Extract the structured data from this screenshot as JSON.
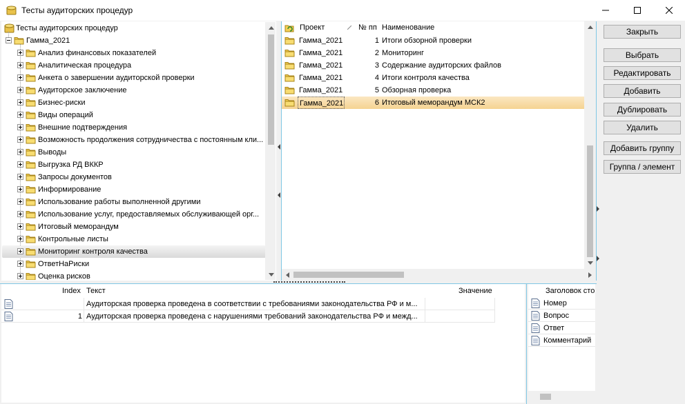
{
  "window": {
    "title": "Тесты аудиторских процедур",
    "controls": {
      "minimize": "minimize",
      "maximize": "maximize",
      "close": "close"
    }
  },
  "tree": {
    "root_label": "Тесты аудиторских процедур",
    "group_label": "Гамма_2021",
    "items": [
      "Анализ финансовых показателей",
      "Аналитическая процедура",
      "Анкета о завершении аудиторской проверки",
      "Аудиторское заключение",
      "Бизнес-риски",
      "Виды операций",
      "Внешние подтверждения",
      "Возможность продолжения сотрудничества с постоянным кли...",
      "Выводы",
      "Выгрузка РД ВККР",
      "Запросы документов",
      "Информирование",
      "Использование работы выполненной другими",
      "Использование услуг, предоставляемых обслуживающей орг...",
      "Итоговый меморандум",
      "Контрольные листы",
      "Мониторинг контроля качества",
      "ОтветНаРиски",
      "Оценка рисков"
    ],
    "selected_index": 16
  },
  "grid": {
    "columns": {
      "project": "Проект",
      "number": "№ пп",
      "name": "Наименование"
    },
    "rows": [
      {
        "project": "Гамма_2021",
        "number": "1",
        "name": "Итоги обзорной проверки"
      },
      {
        "project": "Гамма_2021",
        "number": "2",
        "name": "Мониторинг"
      },
      {
        "project": "Гамма_2021",
        "number": "3",
        "name": "Содержание аудиторских файлов"
      },
      {
        "project": "Гамма_2021",
        "number": "4",
        "name": "Итоги контроля качества"
      },
      {
        "project": "Гамма_2021",
        "number": "5",
        "name": "Обзорная проверка"
      },
      {
        "project": "Гамма_2021",
        "number": "6",
        "name": "Итоговый меморандум МСК2"
      }
    ],
    "selected_index": 5
  },
  "buttons": {
    "close": "Закрыть",
    "select": "Выбрать",
    "edit": "Редактировать",
    "add": "Добавить",
    "duplicate": "Дублировать",
    "delete": "Удалить",
    "add_group": "Добавить группу",
    "group_element": "Группа / элемент"
  },
  "bottom_grid": {
    "columns": {
      "index": "Index",
      "text": "Текст",
      "value": "Значение"
    },
    "rows": [
      {
        "index": "",
        "text": "Аудиторская проверка проведена в соответствии с требованиями законодательства РФ и м...",
        "value": ""
      },
      {
        "index": "1",
        "text": "Аудиторская проверка проведена с нарушениями требований законодательства РФ и межд...",
        "value": ""
      }
    ]
  },
  "right_grid": {
    "header": "Заголовок сто",
    "rows": [
      "Номер",
      "Вопрос",
      "Ответ",
      "Комментарий"
    ]
  }
}
